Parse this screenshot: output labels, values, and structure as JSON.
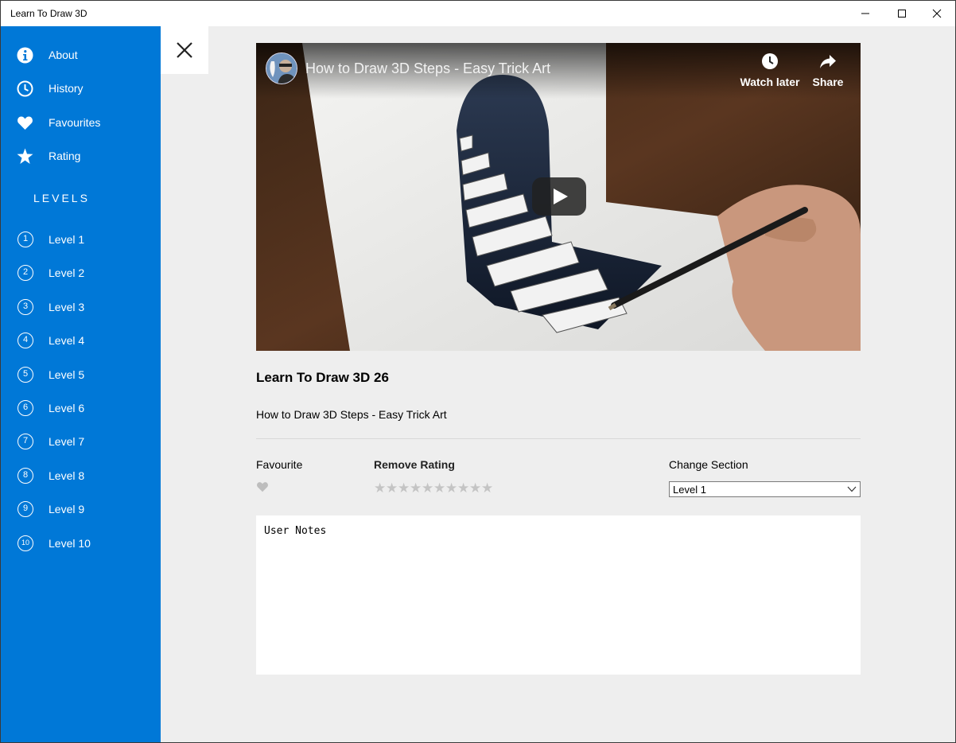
{
  "window": {
    "title": "Learn To Draw 3D"
  },
  "sidebar": {
    "items": [
      {
        "label": "About",
        "icon": "info-icon"
      },
      {
        "label": "History",
        "icon": "clock-icon"
      },
      {
        "label": "Favourites",
        "icon": "heart-icon"
      },
      {
        "label": "Rating",
        "icon": "star-icon"
      }
    ],
    "levels_heading": "LEVELS",
    "levels": [
      {
        "num": "1",
        "label": "Level 1"
      },
      {
        "num": "2",
        "label": "Level 2"
      },
      {
        "num": "3",
        "label": "Level 3"
      },
      {
        "num": "4",
        "label": "Level 4"
      },
      {
        "num": "5",
        "label": "Level 5"
      },
      {
        "num": "6",
        "label": "Level 6"
      },
      {
        "num": "7",
        "label": "Level 7"
      },
      {
        "num": "8",
        "label": "Level 8"
      },
      {
        "num": "9",
        "label": "Level 9"
      },
      {
        "num": "10",
        "label": "Level 10"
      }
    ]
  },
  "video": {
    "title": "How to Draw 3D Steps - Easy Trick Art",
    "watch_later": "Watch later",
    "share": "Share"
  },
  "content": {
    "title": "Learn To Draw 3D 26",
    "subtitle": "How to Draw 3D Steps - Easy Trick Art",
    "favourite_label": "Favourite",
    "remove_rating_label": "Remove Rating",
    "rating_stars": 10,
    "change_section_label": "Change Section",
    "section_selected": "Level 1",
    "notes": "User Notes"
  },
  "colors": {
    "sidebar": "#0078d7",
    "main_bg": "#eeeeee",
    "star_inactive": "#c4c4c4"
  }
}
